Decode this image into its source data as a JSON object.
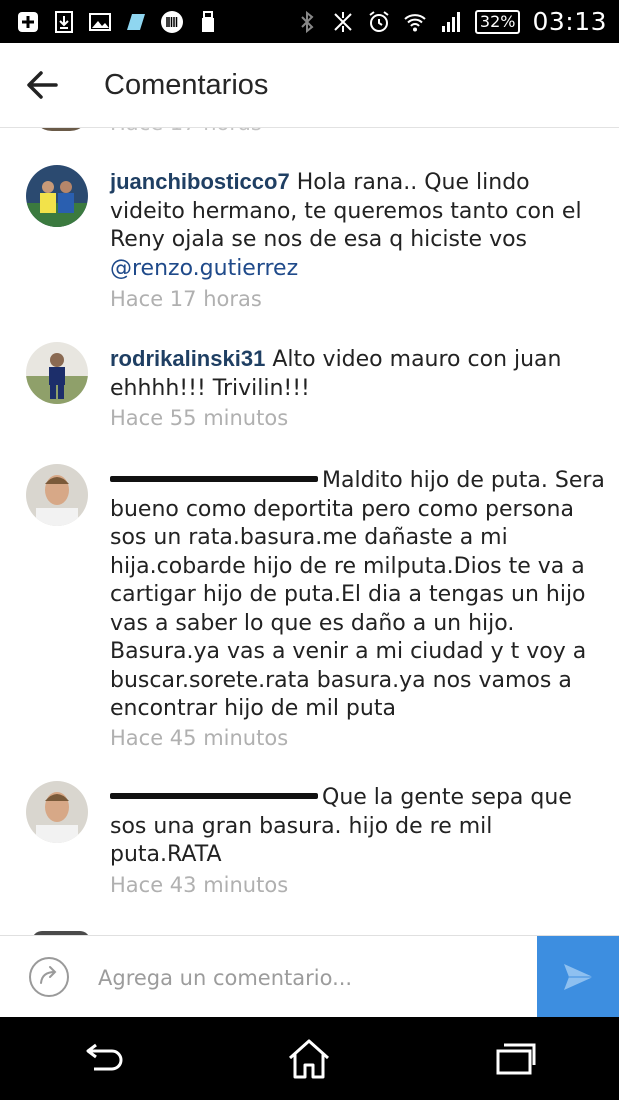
{
  "status_bar": {
    "battery": "32%",
    "time": "03:13"
  },
  "header": {
    "title": "Comentarios"
  },
  "previous_time": "Hace 17 horas",
  "comments": [
    {
      "username": "juanchibosticco7",
      "text": "Hola rana.. Que lindo videito hermano, te queremos tanto con el Reny ojala se nos de esa q hiciste vos",
      "mention": "@renzo.gutierrez",
      "time": "Hace 17 horas"
    },
    {
      "username": "rodrikalinski31",
      "text": "Alto video mauro con juan ehhhh!!! Trivilin!!!",
      "time": "Hace 55 minutos"
    },
    {
      "username_censored": true,
      "text": "Maldito hijo de puta. Sera bueno como deportita pero como persona sos un rata.basura.me dañaste a mi hija.cobarde hijo de re milputa.Dios te va a cartigar hijo de puta.El dia a tengas un hijo vas a saber lo que es daño a un hijo. Basura.ya vas a venir a mi ciudad y t voy a buscar.sorete.rata basura.ya nos vamos a encontrar hijo de mil puta",
      "time": "Hace 45 minutos"
    },
    {
      "username_censored": true,
      "text": "Que la gente sepa que sos una gran basura. hijo de re mil puta.RATA",
      "time": "Hace 43 minutos"
    }
  ],
  "composer": {
    "placeholder": "Agrega un comentario..."
  },
  "colors": {
    "username": "#1f3f63",
    "timestamp": "#b0b0b0",
    "send_button": "#3d8ee0",
    "status_bar": "#000000"
  },
  "icons": {
    "back": "arrow-left-icon",
    "send": "send-arrow-icon",
    "reply": "reply-circle-icon",
    "nav_back": "nav-back-icon",
    "nav_home": "nav-home-icon",
    "nav_recents": "nav-recents-icon"
  }
}
